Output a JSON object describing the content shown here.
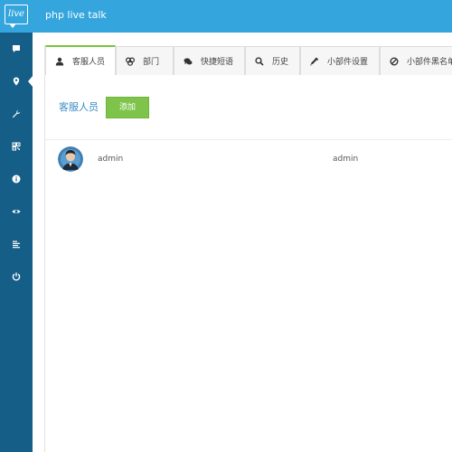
{
  "app": {
    "title": "php live talk",
    "logo_text": "live"
  },
  "colors": {
    "topbar": "#35a6dd",
    "sidebar": "#155e87",
    "accent_green": "#7ec44a",
    "link_blue": "#3a8cc4"
  },
  "sidebar": {
    "items": [
      {
        "icon": "comment-icon"
      },
      {
        "icon": "map-marker-icon",
        "active": true
      },
      {
        "icon": "wrench-icon"
      },
      {
        "icon": "qrcode-icon"
      },
      {
        "icon": "info-icon"
      },
      {
        "icon": "eye-icon"
      },
      {
        "icon": "align-left-icon"
      },
      {
        "icon": "power-icon"
      }
    ]
  },
  "tabs": [
    {
      "label": "客服人员",
      "icon": "user-icon",
      "active": true
    },
    {
      "label": "部门",
      "icon": "sitemap-icon"
    },
    {
      "label": "快捷短语",
      "icon": "chat-icon"
    },
    {
      "label": "历史",
      "icon": "search-icon"
    },
    {
      "label": "小部件设置",
      "icon": "eyedropper-icon"
    },
    {
      "label": "小部件黑名单",
      "icon": "ban-icon"
    }
  ],
  "panel": {
    "title": "客服人员",
    "add_button": "添加"
  },
  "users": [
    {
      "name": "admin",
      "account": "admin"
    }
  ]
}
